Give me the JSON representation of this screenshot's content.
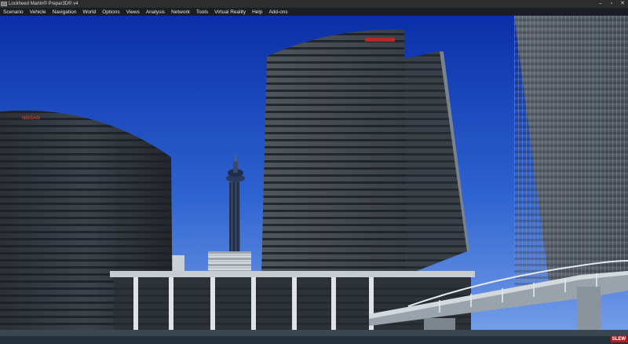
{
  "window": {
    "title": "Lockheed Martin® Prepar3D® v4",
    "controls": {
      "minimize": "–",
      "maximize": "▫",
      "close": "✕"
    }
  },
  "menubar": {
    "items": [
      "Scenario",
      "Vehicle",
      "Navigation",
      "World",
      "Options",
      "Views",
      "Analysis",
      "Network",
      "Tools",
      "Virtual Reality",
      "Help",
      "Add-ons"
    ]
  },
  "scene": {
    "description_icons": [
      "sky",
      "cylindrical-tower",
      "communication-tower",
      "office-highrise",
      "right-highrise",
      "terminal-building",
      "walkway-bridge",
      "water"
    ],
    "left_building_sign": "NISSAN",
    "badge": "SLEW"
  },
  "colors": {
    "sky_top": "#0a2fa8",
    "sky_bottom": "#6f9ae6",
    "titlebar": "#2d2d2d",
    "menubar": "#1a1d24"
  }
}
